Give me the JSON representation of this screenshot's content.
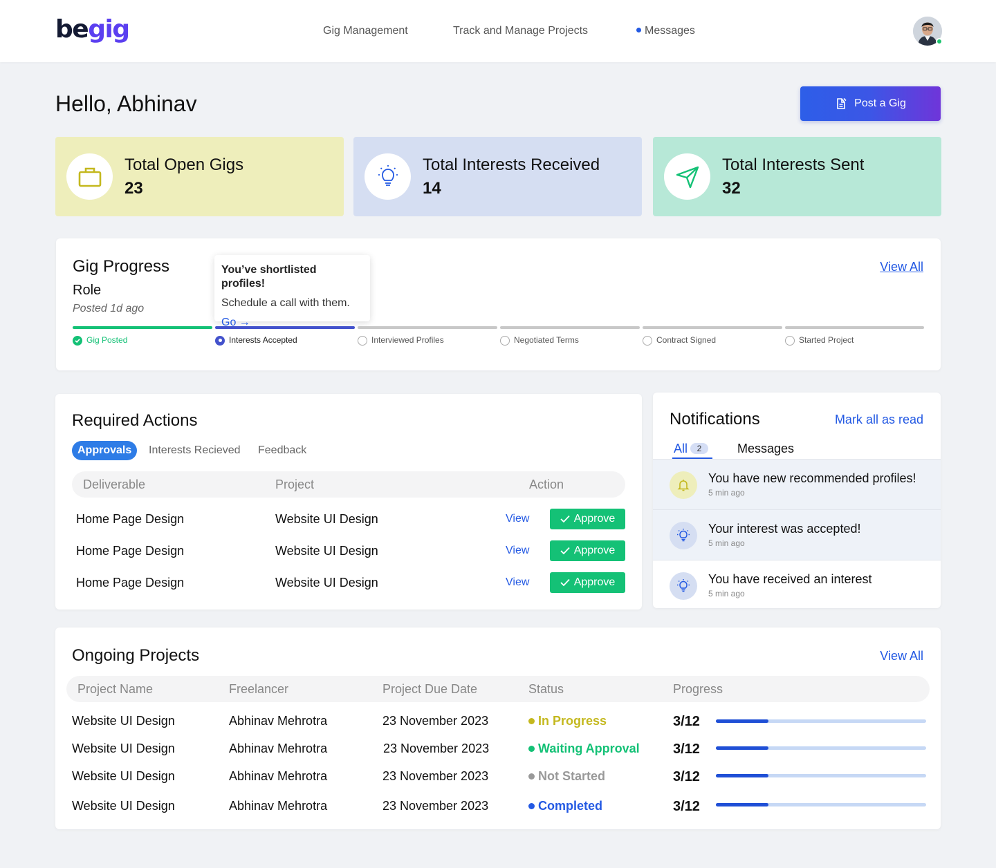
{
  "header": {
    "logo_part1": "be",
    "logo_part2": "gig",
    "nav": [
      "Gig Management",
      "Track and Manage Projects",
      "Messages"
    ]
  },
  "greeting": "Hello, Abhinav",
  "post_button": "Post a Gig",
  "stats": [
    {
      "label": "Total Open Gigs",
      "value": "23",
      "icon": "briefcase-icon",
      "bg": "#eeeebb",
      "accent": "#c4b81e"
    },
    {
      "label": "Total Interests Received",
      "value": "14",
      "icon": "lightbulb-icon",
      "bg": "#d5def2",
      "accent": "#2359e3"
    },
    {
      "label": "Total Interests Sent",
      "value": "32",
      "icon": "send-icon",
      "bg": "#b7e8d7",
      "accent": "#14c176"
    }
  ],
  "gig_progress": {
    "title": "Gig Progress",
    "role": "Role",
    "posted": "Posted 1d ago",
    "view_all": "View All",
    "tooltip": {
      "title": "You’ve shortlisted profiles!",
      "text": "Schedule a call with them.",
      "link": "Go"
    },
    "steps": [
      {
        "label": "Gig Posted",
        "state": "done"
      },
      {
        "label": "Interests Accepted",
        "state": "current"
      },
      {
        "label": "Interviewed Profiles",
        "state": "todo"
      },
      {
        "label": "Negotiated Terms",
        "state": "todo"
      },
      {
        "label": "Contract Signed",
        "state": "todo"
      },
      {
        "label": "Started Project",
        "state": "todo"
      }
    ]
  },
  "required_actions": {
    "title": "Required Actions",
    "tabs": [
      "Approvals",
      "Interests Recieved",
      "Feedback"
    ],
    "columns": [
      "Deliverable",
      "Project",
      "Action"
    ],
    "view_label": "View",
    "approve_label": "Approve",
    "rows": [
      {
        "deliverable": "Home Page Design",
        "project": "Website UI Design"
      },
      {
        "deliverable": "Home Page Design",
        "project": "Website UI Design"
      },
      {
        "deliverable": "Home Page Design",
        "project": "Website UI Design"
      }
    ]
  },
  "notifications": {
    "title": "Notifications",
    "mark_all": "Mark all as read",
    "tab_all": "All",
    "tab_all_count": "2",
    "tab_messages": "Messages",
    "items": [
      {
        "text": "You have new recommended profiles!",
        "time": "5 min ago",
        "icon": "bell-icon",
        "unread": true
      },
      {
        "text": "Your interest was accepted!",
        "time": "5 min ago",
        "icon": "lightbulb-icon",
        "unread": true
      },
      {
        "text": "You have received an interest",
        "time": "5 min ago",
        "icon": "lightbulb-icon",
        "unread": false
      }
    ]
  },
  "ongoing_projects": {
    "title": "Ongoing Projects",
    "view_all": "View All",
    "columns": [
      "Project Name",
      "Freelancer",
      "Project Due Date",
      "Status",
      "Progress"
    ],
    "rows": [
      {
        "name": "Website UI Design",
        "freelancer": "Abhinav Mehrotra",
        "due": "23 November 2023",
        "status": "In Progress",
        "status_color": "#c4b81e",
        "progress_text": "3/12",
        "progress": 0.25
      },
      {
        "name": "Website UI Design",
        "freelancer": "Abhinav Mehrotra",
        "due": "23 November 2023",
        "status": "Waiting Approval",
        "status_color": "#14c176",
        "progress_text": "3/12",
        "progress": 0.25
      },
      {
        "name": "Website UI Design",
        "freelancer": "Abhinav Mehrotra",
        "due": "23 November 2023",
        "status": "Not Started",
        "status_color": "#999999",
        "progress_text": "3/12",
        "progress": 0.25
      },
      {
        "name": "Website UI Design",
        "freelancer": "Abhinav Mehrotra",
        "due": "23 November 2023",
        "status": "Completed",
        "status_color": "#2359e3",
        "progress_text": "3/12",
        "progress": 0.25
      }
    ]
  }
}
